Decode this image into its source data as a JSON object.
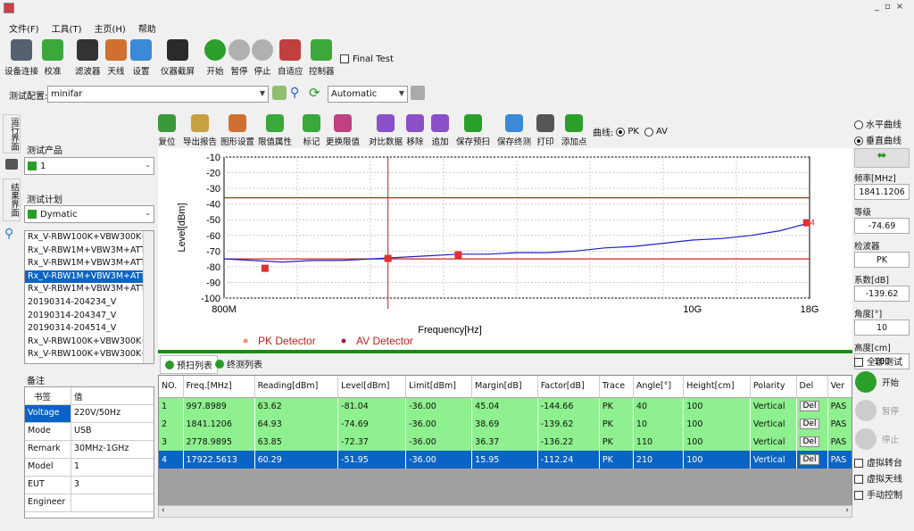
{
  "window": {
    "min": "_",
    "restore": "▫",
    "close": "×"
  },
  "menu": [
    "文件(F)",
    "工具(T)",
    "主页(H)",
    "帮助"
  ],
  "toolbar": [
    {
      "label": "设备连接",
      "color": "#556070"
    },
    {
      "label": "校准",
      "color": "#3aa83a"
    },
    {
      "label": "滤波器",
      "color": "#333333"
    },
    {
      "label": "天线",
      "color": "#d07030"
    },
    {
      "label": "设置",
      "color": "#3a8ad8"
    },
    {
      "label": "仪器截屏",
      "color": "#2a2a2a"
    },
    {
      "label": "开始",
      "color": "#2aa02a"
    },
    {
      "label": "暂停",
      "color": "#b0b0b0"
    },
    {
      "label": "停止",
      "color": "#b0b0b0"
    },
    {
      "label": "自适应",
      "color": "#c04040"
    },
    {
      "label": "控制器",
      "color": "#3aa83a"
    }
  ],
  "final_test": "Final Test",
  "config": {
    "label": "测试配置:",
    "value": "minifar",
    "mode": "Automatic"
  },
  "side_tabs": [
    "运行界面",
    "结果界面"
  ],
  "left": {
    "product_label": "测试产品",
    "product_value": "1",
    "plan_label": "测试计划",
    "plan_value": "Dymatic",
    "items": [
      "Rx_V-RBW100K+VBW300K+A",
      "Rx_V-RBW1M+VBW3M+ATT_",
      "Rx_V-RBW1M+VBW3M+ATT_(",
      "Rx_V-RBW1M+VBW3M+ATT_",
      "Rx_V-RBW1M+VBW3M+ATT_",
      "20190314-204234_V",
      "20190314-204347_V",
      "20190314-204514_V",
      "Rx_V-RBW100K+VBW300K+A",
      "Rx_V-RBW100K+VBW300K+A"
    ],
    "selected_index": 3,
    "notes_label": "备注",
    "props_header": [
      "书签",
      "值"
    ],
    "props": [
      {
        "k": "Voltage",
        "v": "220V/50Hz",
        "sel": true
      },
      {
        "k": "Mode",
        "v": "USB"
      },
      {
        "k": "Remark",
        "v": "30MHz-1GHz"
      },
      {
        "k": "Model",
        "v": "1"
      },
      {
        "k": "EUT",
        "v": "3"
      },
      {
        "k": "Engineer",
        "v": ""
      }
    ]
  },
  "chart_toolbar": [
    {
      "label": "复位",
      "color": "#3a9a3a"
    },
    {
      "label": "导出报告",
      "color": "#c8a040"
    },
    {
      "label": "图形设置",
      "color": "#d07030"
    },
    {
      "label": "限值属性",
      "color": "#3aa83a"
    },
    {
      "label": "标记",
      "color": "#3aa83a"
    },
    {
      "label": "更换限值",
      "color": "#c04080"
    },
    {
      "label": "对比数据",
      "color": "#8a50c8"
    },
    {
      "label": "移除",
      "color": "#8a50c8"
    },
    {
      "label": "追加",
      "color": "#8a50c8"
    },
    {
      "label": "保存预扫",
      "color": "#2aa02a"
    },
    {
      "label": "保存终测",
      "color": "#3a8ad8"
    },
    {
      "label": "打印",
      "color": "#555555"
    },
    {
      "label": "添加点",
      "color": "#2aa02a"
    }
  ],
  "curve": {
    "label": "曲线:",
    "opt1": "PK",
    "opt2": "AV"
  },
  "chart_data": {
    "type": "line",
    "xlabel": "Frequency[Hz]",
    "ylabel": "Level[dBm]",
    "ylim": [
      -100,
      -10
    ],
    "yticks": [
      "-10",
      "-20",
      "-30",
      "-40",
      "-50",
      "-60",
      "-70",
      "-80",
      "-90",
      "-100"
    ],
    "xticks": [
      "800M",
      "10G",
      "18G"
    ],
    "grid": true,
    "legend": [
      "PK Detector",
      "AV Detector"
    ],
    "legend_colors": [
      "#ff9060",
      "#a02050"
    ],
    "limit_lines": [
      -36,
      -75
    ],
    "cursor_frac": 0.28,
    "series_trace": {
      "name": "PK",
      "x_frac": [
        0,
        0.05,
        0.1,
        0.15,
        0.2,
        0.25,
        0.3,
        0.35,
        0.4,
        0.45,
        0.5,
        0.55,
        0.6,
        0.65,
        0.7,
        0.75,
        0.8,
        0.85,
        0.9,
        0.95,
        1.0
      ],
      "y": [
        -75,
        -76,
        -77,
        -76,
        -76,
        -75,
        -74,
        -73,
        -72,
        -72,
        -71,
        -71,
        -70,
        -68,
        -67,
        -65,
        -63,
        -62,
        -60,
        -57,
        -52
      ]
    },
    "markers": [
      {
        "x_frac": 0.07,
        "y": -81,
        "label": "1"
      },
      {
        "x_frac": 0.28,
        "y": -74.69,
        "label": "2"
      },
      {
        "x_frac": 0.4,
        "y": -72.37,
        "label": "3"
      },
      {
        "x_frac": 0.995,
        "y": -51.95,
        "label": "4"
      }
    ]
  },
  "result_tabs": [
    "预扫列表",
    "终测列表"
  ],
  "table": {
    "headers": [
      "NO.",
      "Freq.[MHz]",
      "Reading[dBm]",
      "Level[dBm]",
      "Limit[dBm]",
      "Margin[dB]",
      "Factor[dB]",
      "Trace",
      "Angle[°]",
      "Height[cm]",
      "Polarity",
      "Del",
      "Ver"
    ],
    "rows": [
      [
        "1",
        "997.8989",
        "63.62",
        "-81.04",
        "-36.00",
        "45.04",
        "-144.66",
        "PK",
        "40",
        "100",
        "Vertical",
        "Del",
        "PAS"
      ],
      [
        "2",
        "1841.1206",
        "64.93",
        "-74.69",
        "-36.00",
        "38.69",
        "-139.62",
        "PK",
        "10",
        "100",
        "Vertical",
        "Del",
        "PAS"
      ],
      [
        "3",
        "2778.9895",
        "63.85",
        "-72.37",
        "-36.00",
        "36.37",
        "-136.22",
        "PK",
        "110",
        "100",
        "Vertical",
        "Del",
        "PAS"
      ],
      [
        "4",
        "17922.5613",
        "60.29",
        "-51.95",
        "-36.00",
        "15.95",
        "-112.24",
        "PK",
        "210",
        "100",
        "Vertical",
        "Del",
        "PAS"
      ]
    ],
    "selected_row": 3
  },
  "right": {
    "h_curve": "水平曲线",
    "v_curve": "垂直曲线",
    "fields": [
      {
        "label": "频率[MHz]",
        "value": "1841.1206"
      },
      {
        "label": "等级",
        "value": "-74.69"
      },
      {
        "label": "检波器",
        "value": "PK"
      },
      {
        "label": "系数[dB]",
        "value": "-139.62"
      },
      {
        "label": "角度[°]",
        "value": "10"
      },
      {
        "label": "高度[cm]",
        "value": "100"
      }
    ],
    "full_test": "全部测试",
    "start": "开始",
    "pause": "暂停",
    "stop": "停止",
    "checks": [
      "虚拟转台",
      "虚拟天线",
      "手动控制"
    ]
  }
}
